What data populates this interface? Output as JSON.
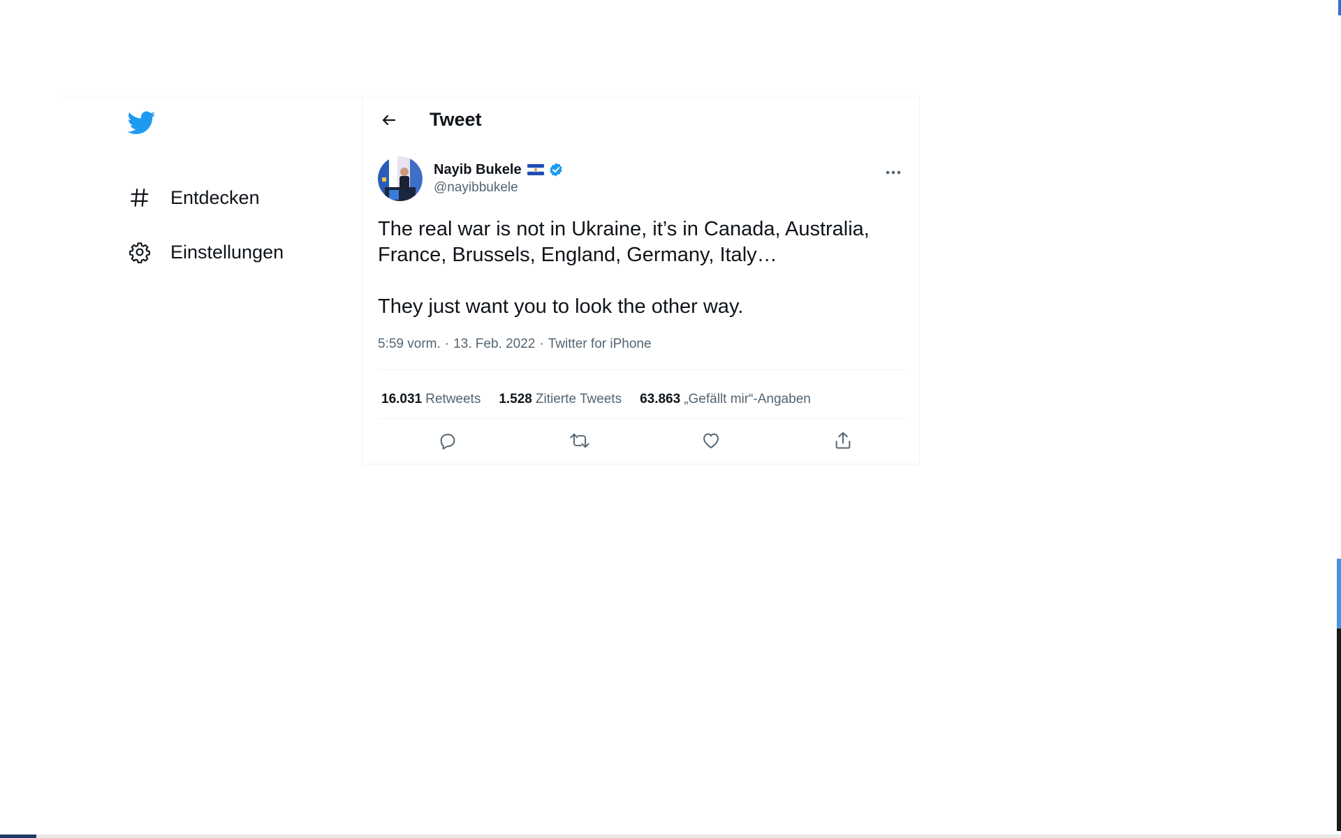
{
  "sidebar": {
    "logo": "twitter-bird-icon",
    "items": [
      {
        "label": "Entdecken",
        "icon": "hashtag-icon"
      },
      {
        "label": "Einstellungen",
        "icon": "gear-icon"
      }
    ]
  },
  "header": {
    "title": "Tweet",
    "back_icon": "arrow-left-icon"
  },
  "tweet": {
    "author": {
      "name": "Nayib Bukele",
      "flag": "el-salvador-flag",
      "verified": true,
      "handle": "@nayibbukele"
    },
    "text_line1": "The real war is not in Ukraine, it’s in Canada, Australia, France, Brussels, England, Germany, Italy…",
    "text_line2": "They just want you to look the other way.",
    "time": "5:59 vorm.",
    "date": "13. Feb. 2022",
    "source": "Twitter for iPhone",
    "separator": "·",
    "stats": {
      "retweets_count": "16.031",
      "retweets_label": "Retweets",
      "quotes_count": "1.528",
      "quotes_label": "Zitierte Tweets",
      "likes_count": "63.863",
      "likes_label": "„Gefällt mir“-Angaben"
    },
    "actions": [
      "reply-icon",
      "retweet-icon",
      "like-icon",
      "share-icon"
    ]
  },
  "colors": {
    "brand": "#1d9bf0",
    "text": "#0f1419",
    "secondary": "#536471",
    "divider": "#eff3f4"
  }
}
